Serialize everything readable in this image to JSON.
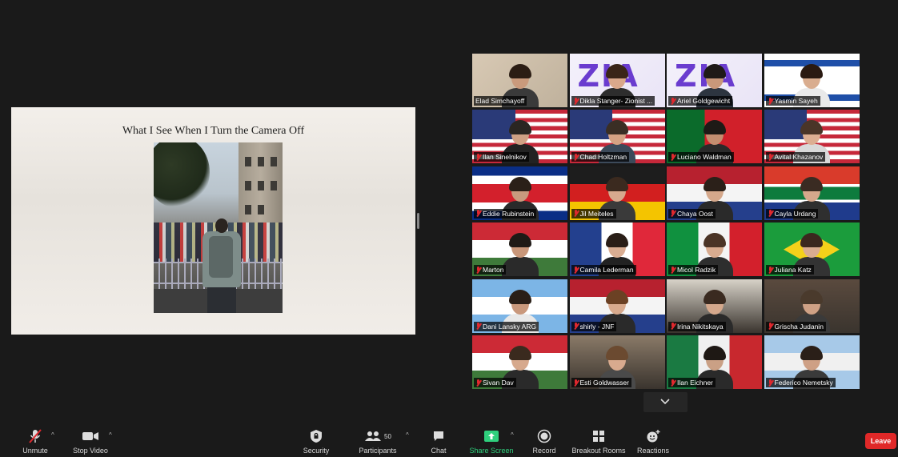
{
  "slide": {
    "title": "What I See When I Turn the Camera Off"
  },
  "gallery": {
    "participants": [
      {
        "name": "Elad Simchayoff",
        "muted": false,
        "active": true,
        "bg": [
          "#d8c9b4",
          "#bfb19c"
        ],
        "shirt": "#3a3a3a",
        "hair": "#2b1d14",
        "skin": "#c99a7c"
      },
      {
        "name": "Dikla Stanger- Zionist ...",
        "muted": true,
        "bg": [
          "#f4f1fb",
          "#e9e4f6"
        ],
        "logo": "ZIA",
        "shirt": "#2d2d2d",
        "hair": "#3a2518",
        "skin": "#d9a88b"
      },
      {
        "name": "Ariel Goldgewicht",
        "muted": true,
        "bg": [
          "#f4f1fb",
          "#e9e4f6"
        ],
        "logo": "ZIA",
        "shirt": "#2d3540",
        "hair": "#1f1a17",
        "skin": "#c9987a"
      },
      {
        "name": "Yasmin Sayeh",
        "muted": true,
        "flag": "israel",
        "shirt": "#e9e9e9",
        "hair": "#2a1a12",
        "skin": "#d9ad8f"
      },
      {
        "name": "Ilan Sinelnikov",
        "muted": true,
        "flag": "usa",
        "shirt": "#222",
        "hair": "#2a2622",
        "skin": "#cfa184"
      },
      {
        "name": "Chad Holtzman",
        "muted": true,
        "flag": "usa",
        "shirt": "#3c4a5a",
        "hair": "#3a2e24",
        "skin": "#d5a283"
      },
      {
        "name": "Luciano Waldman",
        "muted": true,
        "flag": "portugal",
        "shirt": "#2a2a2a",
        "hair": "#1e1a16",
        "skin": "#c48e70"
      },
      {
        "name": "Avital Khazanov",
        "muted": true,
        "flag": "usa",
        "shirt": "#d9d9d9",
        "hair": "#4a3528",
        "skin": "#dcae92"
      },
      {
        "name": "Eddie Rubinstein",
        "muted": true,
        "flag": "costa-rica",
        "shirt": "#2a2a2a",
        "hair": "#2a2018",
        "skin": "#c89a7e"
      },
      {
        "name": "Jil Meiteles",
        "muted": true,
        "flag": "germany",
        "shirt": "#3a3a3a",
        "hair": "#3b2a1f",
        "skin": "#d7a98e"
      },
      {
        "name": "Chaya Oost",
        "muted": true,
        "flag": "netherlands",
        "shirt": "#2a2a2a",
        "hair": "#2b2019",
        "skin": "#d5a88b"
      },
      {
        "name": "Cayla Urdang",
        "muted": true,
        "flag": "south-africa",
        "shirt": "#2f2f2f",
        "hair": "#3a2b22",
        "skin": "#d6a88c"
      },
      {
        "name": "Marton",
        "muted": true,
        "flag": "hungary",
        "shirt": "#2a2a2a",
        "hair": "#1f1a16",
        "skin": "#c9977a"
      },
      {
        "name": "Camila Lederman",
        "muted": true,
        "flag": "france",
        "shirt": "#222",
        "hair": "#2a1e17",
        "skin": "#d9ad92"
      },
      {
        "name": "Micol Radzik",
        "muted": true,
        "flag": "italy",
        "shirt": "#2e2e2e",
        "hair": "#4b3426",
        "skin": "#d8ab8f"
      },
      {
        "name": "Juliana Katz",
        "muted": true,
        "flag": "brazil",
        "shirt": "#333",
        "hair": "#3b281e",
        "skin": "#d9ac90"
      },
      {
        "name": "Dani Lansky ARG",
        "muted": true,
        "flag": "argentina",
        "shirt": "#e8e8e8",
        "hair": "#2a1f18",
        "skin": "#c9987c"
      },
      {
        "name": "shirly - JNF",
        "muted": true,
        "flag": "netherlands",
        "shirt": "#2a2a2a",
        "hair": "#6b4124",
        "skin": "#d8aa8d"
      },
      {
        "name": "Irina Nikitskaya",
        "muted": true,
        "room": "#d7d2c8",
        "shirt": "#2a2a2a",
        "hair": "#3a2a20",
        "skin": "#d4a88c"
      },
      {
        "name": "Grischa Judanin",
        "muted": true,
        "room": "#5a4a3e",
        "shirt": "#3a3a3a",
        "hair": "#4a3a2c",
        "skin": "#cfa185"
      },
      {
        "name": "Sivan Dav",
        "muted": true,
        "flag": "hungary",
        "shirt": "#2a2a2a",
        "hair": "#3a2a1e",
        "skin": "#d6a98d"
      },
      {
        "name": "Esti Goldwasser",
        "muted": true,
        "room": "#8a7a68",
        "shirt": "#4a4a4a",
        "hair": "#6b4a30",
        "skin": "#d8aa8e"
      },
      {
        "name": "Ilan Eichner",
        "muted": true,
        "flag": "mexico",
        "shirt": "#2a2a2a",
        "hair": "#1e1814",
        "skin": "#caa085"
      },
      {
        "name": "Federico Nemetsky",
        "muted": true,
        "flag": "argentina-pale",
        "shirt": "#3a3a3a",
        "hair": "#2a1f18",
        "skin": "#ceA085"
      }
    ]
  },
  "toolbar": {
    "unmute": "Unmute",
    "stop_video": "Stop Video",
    "security": "Security",
    "participants": "Participants",
    "participants_count": "50",
    "chat": "Chat",
    "share_screen": "Share Screen",
    "record": "Record",
    "breakout_rooms": "Breakout Rooms",
    "reactions": "Reactions",
    "leave": "Leave"
  },
  "colors": {
    "active_speaker": "#b5d240",
    "share_green": "#2fd07d",
    "leave_red": "#e02828",
    "muted_red": "#e0282e"
  }
}
